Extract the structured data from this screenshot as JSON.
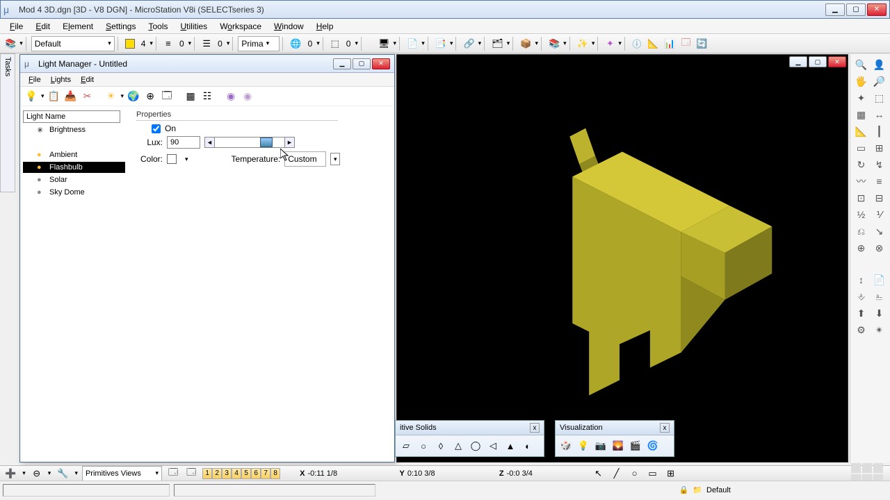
{
  "title": "Mod 4 3D.dgn [3D - V8 DGN] - MicroStation V8i (SELECTseries 3)",
  "mainMenu": [
    "File",
    "Edit",
    "Element",
    "Settings",
    "Tools",
    "Utilities",
    "Workspace",
    "Window",
    "Help"
  ],
  "toolbar": {
    "levelDropdown": "Default",
    "num4": "4",
    "num0a": "0",
    "num0b": "0",
    "prima": "Prima",
    "num0c": "0",
    "num0d": "0"
  },
  "tasksLabel": "Tasks",
  "lightManager": {
    "title": "Light Manager - Untitled",
    "menu": [
      "File",
      "Lights",
      "Edit"
    ],
    "listHeader": "Light Name",
    "items": [
      {
        "name": "Brightness",
        "icon": "✳"
      },
      {
        "name": "Ambient",
        "icon": "●"
      },
      {
        "name": "Flashbulb",
        "icon": "●",
        "selected": true
      },
      {
        "name": "Solar",
        "icon": "●"
      },
      {
        "name": "Sky Dome",
        "icon": "●"
      }
    ],
    "propsLabel": "Properties",
    "onLabel": "On",
    "onChecked": true,
    "luxLabel": "Lux:",
    "luxValue": "90",
    "colorLabel": "Color:",
    "tempLabel": "Temperature:",
    "tempValue": "Custom"
  },
  "floatSolids": {
    "title": "itive Solids"
  },
  "floatViz": {
    "title": "Visualization"
  },
  "bottomBar": {
    "viewSelect": "Primitives Views",
    "numButtons": [
      "1",
      "2",
      "3",
      "4",
      "5",
      "6",
      "7",
      "8"
    ],
    "coords": {
      "X": "-0:11 1/8",
      "Y": "0:10 3/8",
      "Z": "-0:0 3/4"
    }
  },
  "status": {
    "default": "Default"
  }
}
